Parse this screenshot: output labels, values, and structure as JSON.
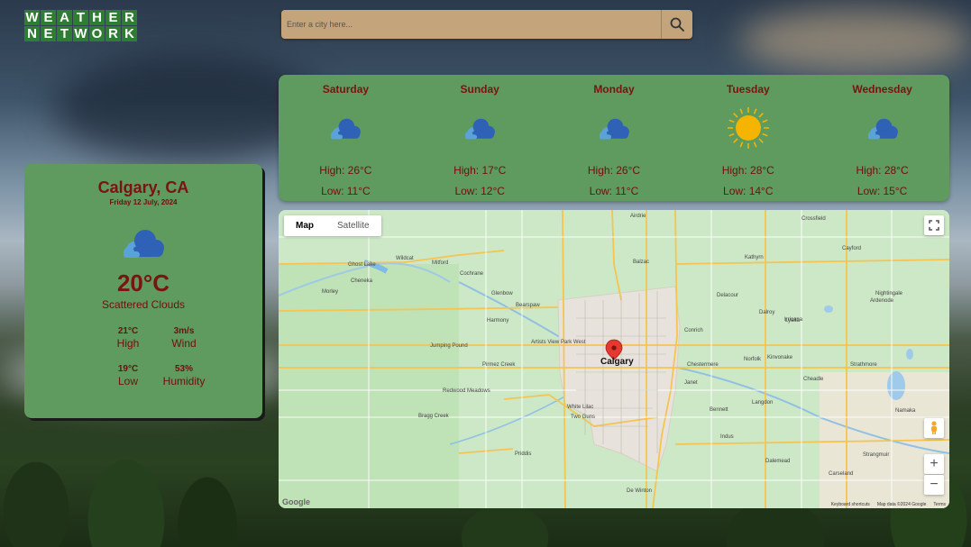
{
  "logo": {
    "letters": [
      "W",
      "E",
      "A",
      "T",
      "H",
      "E",
      "R",
      "N",
      "E",
      "T",
      "W",
      "O",
      "R",
      "K"
    ]
  },
  "search": {
    "placeholder": "Enter a city here...",
    "icon": "search-icon"
  },
  "current": {
    "city": "Calgary, CA",
    "date": "Friday 12 July, 2024",
    "icon": "cloud-icon",
    "temperature": "20°C",
    "description": "Scattered Clouds",
    "high_value": "21°C",
    "high_label": "High",
    "wind_value": "3m/s",
    "wind_label": "Wind",
    "low_value": "19°C",
    "low_label": "Low",
    "humidity_value": "53%",
    "humidity_label": "Humidity"
  },
  "forecast": [
    {
      "day": "Saturday",
      "icon": "cloud-icon",
      "high": "High: 26°C",
      "low": "Low: 11°C"
    },
    {
      "day": "Sunday",
      "icon": "cloud-icon",
      "high": "High: 17°C",
      "low": "Low: 12°C"
    },
    {
      "day": "Monday",
      "icon": "cloud-icon",
      "high": "High: 26°C",
      "low": "Low: 11°C"
    },
    {
      "day": "Tuesday",
      "icon": "sun-icon",
      "high": "High: 28°C",
      "low": "Low: 14°C"
    },
    {
      "day": "Wednesday",
      "icon": "cloud-icon",
      "high": "High: 28°C",
      "low": "Low: 15°C"
    }
  ],
  "map": {
    "type_map": "Map",
    "type_satellite": "Satellite",
    "main_city": "Calgary",
    "towns": [
      "Airdrie",
      "Crossfield",
      "Cayford",
      "Ghost Lake",
      "Wildcat",
      "Mitford",
      "Cochrane",
      "Cheneka",
      "Morley",
      "Balzac",
      "Kathyrn",
      "Delacour",
      "Dalroy",
      "Irricana",
      "Nightingale",
      "Ardenode",
      "Glenbow",
      "Bearspaw",
      "Harmony",
      "Jumping Pound",
      "Artists View Park West",
      "Conrich",
      "Chestermere",
      "Norfolk",
      "Kinvonake",
      "Strathmore",
      "Redwood Meadows",
      "Priddis",
      "Bragg Creek",
      "Two Guns",
      "White Lilac",
      "Janet",
      "Indus",
      "Dalemead",
      "Langdon",
      "De Winton",
      "Namaka",
      "Carseland",
      "Strangmuir",
      "Cheadle",
      "Lyalta",
      "Bennett",
      "Pirmez Creek"
    ],
    "zoom_in": "+",
    "zoom_out": "−",
    "footer_shortcuts": "Keyboard shortcuts",
    "footer_data": "Map data ©2024 Google",
    "footer_terms": "Terms",
    "google_logo": "Google"
  }
}
